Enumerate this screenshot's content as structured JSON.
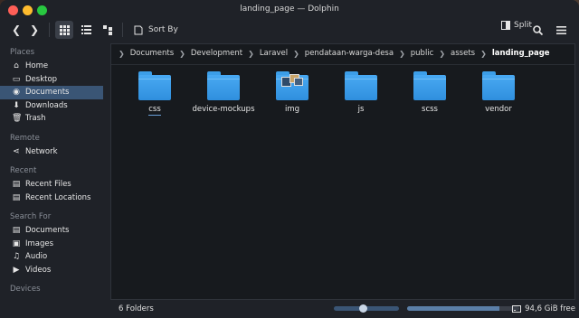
{
  "window": {
    "title": "landing_page — Dolphin"
  },
  "toolbar": {
    "back_icon": "back-icon",
    "forward_icon": "forward-icon",
    "sort_label": "Sort By",
    "split_label": "Split"
  },
  "sidebar": {
    "places_title": "Places",
    "places": [
      {
        "label": "Home",
        "icon": "home-icon"
      },
      {
        "label": "Desktop",
        "icon": "desktop-icon"
      },
      {
        "label": "Documents",
        "icon": "documents-icon",
        "selected": true
      },
      {
        "label": "Downloads",
        "icon": "downloads-icon"
      },
      {
        "label": "Trash",
        "icon": "trash-icon"
      }
    ],
    "remote_title": "Remote",
    "remote": [
      {
        "label": "Network",
        "icon": "network-icon"
      }
    ],
    "recent_title": "Recent",
    "recent": [
      {
        "label": "Recent Files",
        "icon": "recent-files-icon"
      },
      {
        "label": "Recent Locations",
        "icon": "recent-locations-icon"
      }
    ],
    "search_title": "Search For",
    "search": [
      {
        "label": "Documents",
        "icon": "search-documents-icon"
      },
      {
        "label": "Images",
        "icon": "images-icon"
      },
      {
        "label": "Audio",
        "icon": "audio-icon"
      },
      {
        "label": "Videos",
        "icon": "videos-icon"
      }
    ],
    "devices_title": "Devices"
  },
  "breadcrumb": [
    "Documents",
    "Development",
    "Laravel",
    "pendataan-warga-desa",
    "public",
    "assets",
    "landing_page"
  ],
  "files": [
    {
      "name": "css",
      "type": "folder"
    },
    {
      "name": "device-mockups",
      "type": "folder"
    },
    {
      "name": "img",
      "type": "folder-preview"
    },
    {
      "name": "js",
      "type": "folder"
    },
    {
      "name": "scss",
      "type": "folder"
    },
    {
      "name": "vendor",
      "type": "folder"
    }
  ],
  "status": {
    "count": "6 Folders",
    "free": "94,6 GiB free",
    "zoom_level": 0.45,
    "space_used": 0.82
  },
  "colors": {
    "accent": "#3a5575",
    "folder": "#3c9ee8"
  }
}
